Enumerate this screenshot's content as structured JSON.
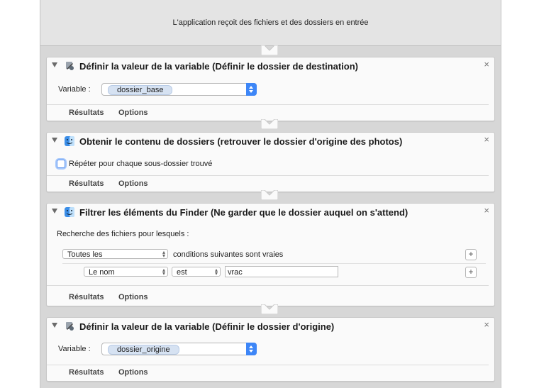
{
  "header": {
    "text": "L'application reçoit des fichiers et des dossiers en entrée"
  },
  "tabs": {
    "results": "Résultats",
    "options": "Options"
  },
  "actions": [
    {
      "title": "Définir la valeur de la variable (Définir le dossier de destination)",
      "variable_label": "Variable :",
      "variable_value": "dossier_base",
      "icon": "variable-icon"
    },
    {
      "title": "Obtenir le contenu de dossiers (retrouver le dossier d'origine des photos)",
      "checkbox_label": "Répéter pour chaque sous-dossier trouvé",
      "checked": false,
      "icon": "finder-icon"
    },
    {
      "title": "Filtrer les éléments du Finder (Ne garder que le dossier auquel on s'attend)",
      "search_label": "Recherche des fichiers pour lesquels :",
      "condition_select": "Toutes les",
      "condition_text": "conditions suivantes sont vraies",
      "criterion_field": "Le nom",
      "criterion_operator": "est",
      "criterion_value": "vrac",
      "icon": "finder-icon"
    },
    {
      "title": "Définir la valeur de la variable (Définir le dossier d'origine)",
      "variable_label": "Variable :",
      "variable_value": "dossier_origine",
      "icon": "variable-icon"
    }
  ],
  "close_glyph": "×",
  "plus_glyph": "+"
}
